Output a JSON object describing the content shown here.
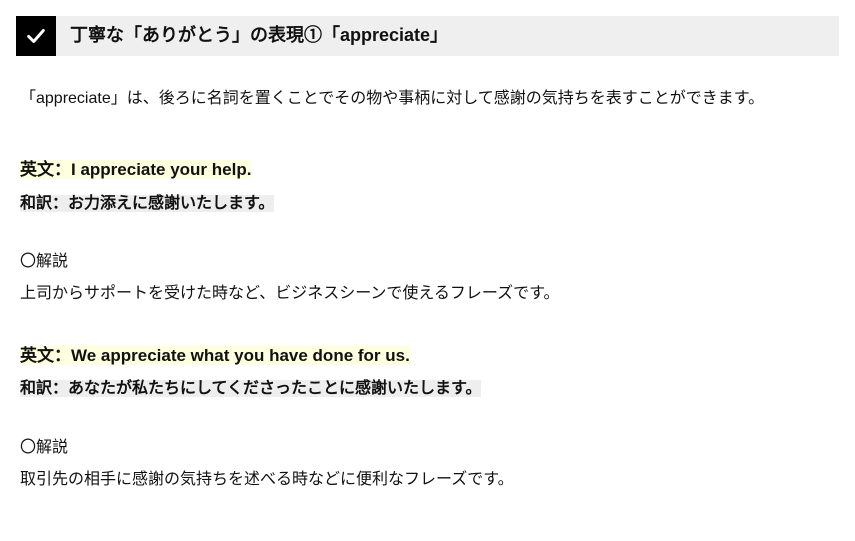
{
  "heading": "丁寧な「ありがとう」の表現①「appreciate」",
  "intro": "「appreciate」は、後ろに名詞を置くことでその物や事柄に対して感謝の気持ちを表すことができます。",
  "labels": {
    "english_prefix": "英文：",
    "japanese_prefix": "和訳：",
    "explain": "〇解説"
  },
  "entries": [
    {
      "english": "I appreciate your help.",
      "japanese": "お力添えに感謝いたします。",
      "explain": "上司からサポートを受けた時など、ビジネスシーンで使えるフレーズです。"
    },
    {
      "english": "We appreciate what you have done for us.",
      "japanese": "あなたが私たちにしてくださったことに感謝いたします。",
      "explain": "取引先の相手に感謝の気持ちを述べる時などに便利なフレーズです。"
    }
  ]
}
